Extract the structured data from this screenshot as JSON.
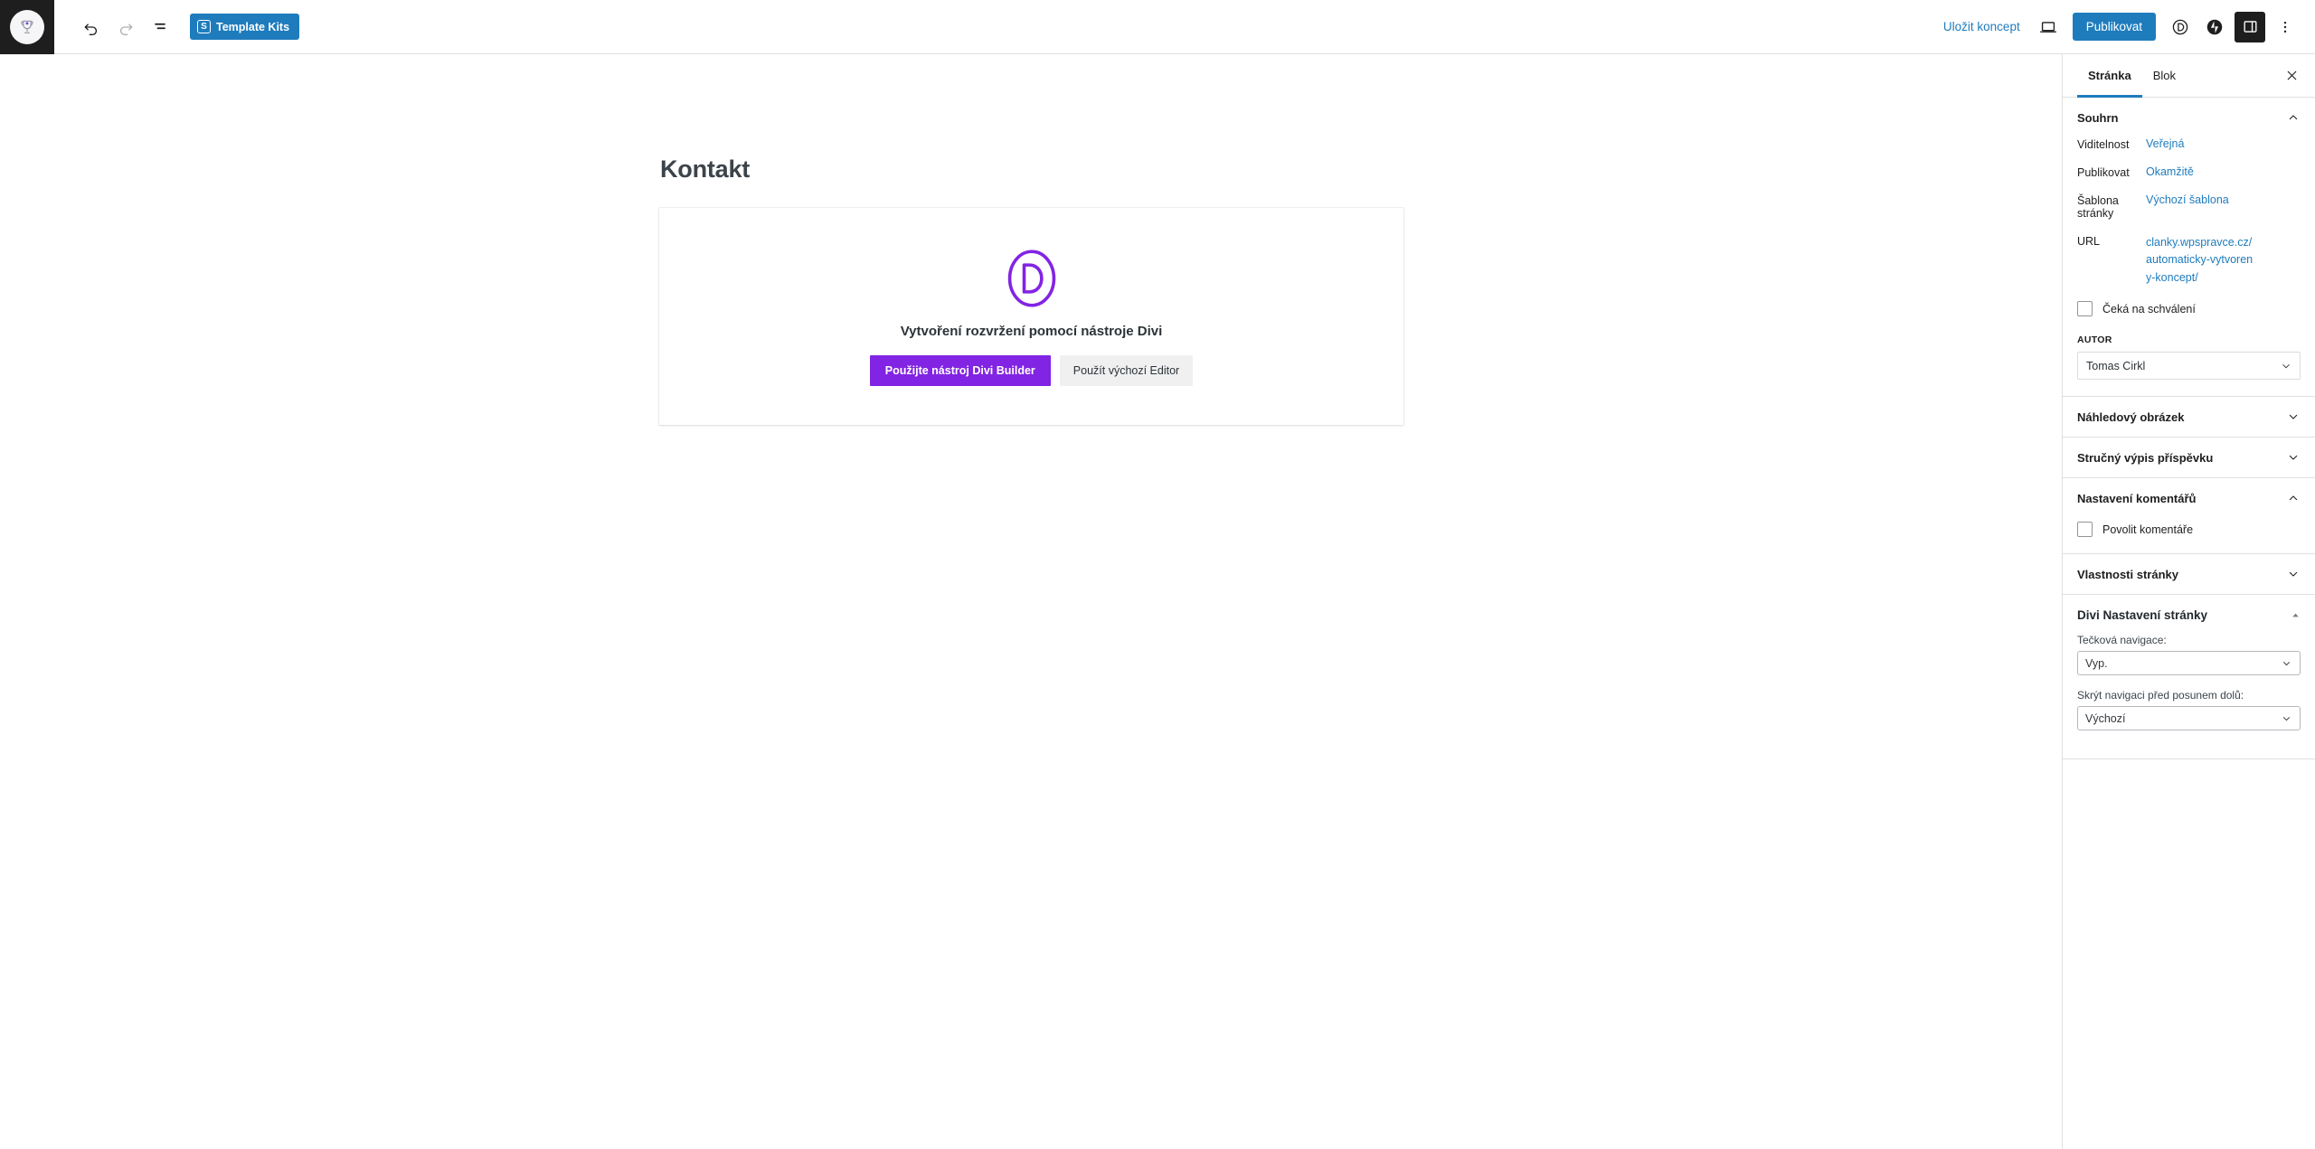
{
  "topbar": {
    "wp_logo_icon": "trophy-icon",
    "undo_icon": "undo-arrow-icon",
    "redo_icon": "redo-arrow-icon",
    "list_view_icon": "document-overview-icon",
    "template_kits_label": "Template Kits",
    "template_kits_badge": "S",
    "save_draft_label": "Uložit koncept",
    "preview_icon": "laptop-preview-icon",
    "publish_label": "Publikovat",
    "divi_icon": "divi-d-circle-icon",
    "jetpack_icon": "jetpack-lightning-icon",
    "settings_toggle_icon": "sidebar-panel-icon",
    "more_options_icon": "three-dots-vertical-icon"
  },
  "canvas": {
    "post_title": "Kontakt",
    "divi_card": {
      "logo_icon": "divi-d-circle-logo",
      "heading": "Vytvoření rozvržení pomocí nástroje Divi",
      "primary_button": "Použijte nástroj Divi Builder",
      "secondary_button": "Použít výchozí Editor"
    }
  },
  "sidebar": {
    "tabs": [
      {
        "label": "Stránka",
        "active": true
      },
      {
        "label": "Blok",
        "active": false
      }
    ],
    "close_icon": "close-x-icon",
    "summary_panel": {
      "title": "Souhrn",
      "expanded": true,
      "chevron_icon": "chevron-up-icon",
      "rows": [
        {
          "label": "Viditelnost",
          "value": "Veřejná"
        },
        {
          "label": "Publikovat",
          "value": "Okamžitě"
        },
        {
          "label": "Šablona stránky",
          "value": "Výchozí šablona"
        },
        {
          "label": "URL",
          "value": "clanky.wpspravce.cz/automaticky-vytvoreny-koncept/"
        }
      ],
      "pending_review_label": "Čeká na schválení",
      "pending_review_checked": false,
      "author_label": "AUTOR",
      "author_value": "Tomas Cirkl"
    },
    "collapsed_panels": [
      {
        "title": "Náhledový obrázek",
        "chevron_icon": "chevron-down-icon"
      },
      {
        "title": "Stručný výpis příspěvku",
        "chevron_icon": "chevron-down-icon"
      }
    ],
    "comments_panel": {
      "title": "Nastavení komentářů",
      "expanded": true,
      "chevron_icon": "chevron-up-icon",
      "allow_comments_label": "Povolit komentáře",
      "allow_comments_checked": false
    },
    "page_attributes_panel": {
      "title": "Vlastnosti stránky",
      "chevron_icon": "chevron-down-icon"
    },
    "divi_panel": {
      "title": "Divi Nastavení stránky",
      "expanded": true,
      "chevron_icon": "chevron-up-small-icon",
      "fields": [
        {
          "label": "Tečková navigace:",
          "value": "Vyp.",
          "chevron_icon": "chevron-down-icon"
        },
        {
          "label": "Skrýt navigaci před posunem dolů:",
          "value": "Výchozí",
          "chevron_icon": "chevron-down-icon"
        }
      ]
    }
  },
  "colors": {
    "wp_blue": "#1e7cbd",
    "divi_purple": "#8224e3",
    "dark_chrome": "#1e1e1e",
    "border_gray": "#e0e0e0"
  }
}
